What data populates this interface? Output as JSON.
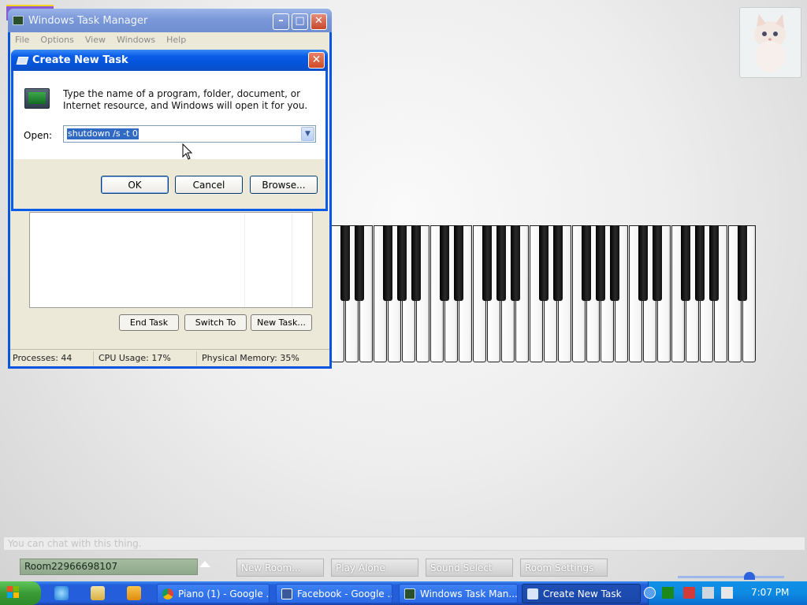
{
  "task_manager": {
    "title": "Windows Task Manager",
    "menu": [
      "File",
      "Options",
      "View",
      "Windows",
      "Help"
    ],
    "buttons": {
      "end_task": "End Task",
      "switch_to": "Switch To",
      "new_task": "New Task..."
    },
    "status": {
      "processes": "Processes: 44",
      "cpu": "CPU Usage: 17%",
      "memory": "Physical Memory: 35%"
    }
  },
  "create_task_dialog": {
    "title": "Create New Task",
    "message": "Type the name of a program, folder, document, or Internet resource, and Windows will open it for you.",
    "open_label": "Open:",
    "open_value": "shutdown /s -t 0",
    "buttons": {
      "ok": "OK",
      "cancel": "Cancel",
      "browse": "Browse..."
    }
  },
  "piano_app": {
    "chat_placeholder": "You can chat with this thing.",
    "room_name": "Room22966698107",
    "buttons": {
      "new_room": "New Room...",
      "play_alone": "Play Alone",
      "sound_select": "Sound Select",
      "room_settings": "Room Settings"
    }
  },
  "taskbar": {
    "tasks": [
      {
        "label": "Piano (1) - Google ...",
        "icon": "chrome-icon"
      },
      {
        "label": "Facebook - Google ...",
        "icon": "facebook-icon"
      },
      {
        "label": "Windows Task Man...",
        "icon": "task-manager-icon"
      },
      {
        "label": "Create New Task",
        "icon": "create-task-icon"
      }
    ],
    "clock": "7:07 PM"
  },
  "colors": {
    "xp_blue": "#245edb",
    "selection": "#316ac5",
    "dialog_face": "#ece9d8"
  }
}
